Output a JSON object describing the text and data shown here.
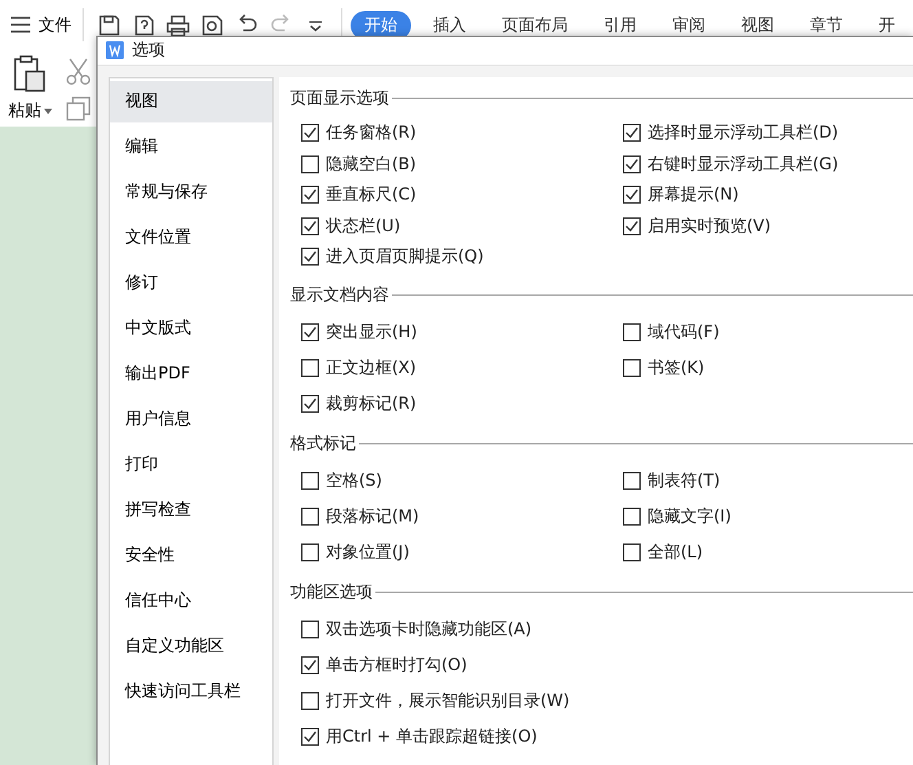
{
  "toolbar": {
    "menu_label": "文件",
    "tabs": [
      {
        "label": "开始",
        "selected": true
      },
      {
        "label": "插入",
        "selected": false
      },
      {
        "label": "页面布局",
        "selected": false
      },
      {
        "label": "引用",
        "selected": false
      },
      {
        "label": "审阅",
        "selected": false
      },
      {
        "label": "视图",
        "selected": false
      },
      {
        "label": "章节",
        "selected": false
      },
      {
        "label": "开",
        "selected": false
      }
    ],
    "paste_label": "粘贴"
  },
  "dialog": {
    "title": "选项",
    "nav": [
      {
        "label": "视图",
        "selected": true
      },
      {
        "label": "编辑",
        "selected": false
      },
      {
        "label": "常规与保存",
        "selected": false
      },
      {
        "label": "文件位置",
        "selected": false
      },
      {
        "label": "修订",
        "selected": false
      },
      {
        "label": "中文版式",
        "selected": false
      },
      {
        "label": "输出PDF",
        "selected": false
      },
      {
        "label": "用户信息",
        "selected": false
      },
      {
        "label": "打印",
        "selected": false
      },
      {
        "label": "拼写检查",
        "selected": false
      },
      {
        "label": "安全性",
        "selected": false
      },
      {
        "label": "信任中心",
        "selected": false
      },
      {
        "label": "自定义功能区",
        "selected": false
      },
      {
        "label": "快速访问工具栏",
        "selected": false
      }
    ],
    "sections": [
      {
        "title": "页面显示选项",
        "kind": "compact-grid",
        "options": [
          {
            "label": "任务窗格(R)",
            "checked": true
          },
          {
            "label": "选择时显示浮动工具栏(D)",
            "checked": true
          },
          {
            "label": "隐藏空白(B)",
            "checked": false
          },
          {
            "label": "右键时显示浮动工具栏(G)",
            "checked": true
          },
          {
            "label": "垂直标尺(C)",
            "checked": true
          },
          {
            "label": "屏幕提示(N)",
            "checked": true
          },
          {
            "label": "状态栏(U)",
            "checked": true
          },
          {
            "label": "启用实时预览(V)",
            "checked": true
          },
          {
            "label": "进入页眉页脚提示(Q)",
            "checked": true
          }
        ]
      },
      {
        "title": "显示文档内容",
        "kind": "grid",
        "options": [
          {
            "label": "突出显示(H)",
            "checked": true
          },
          {
            "label": "域代码(F)",
            "checked": false
          },
          {
            "label": "正文边框(X)",
            "checked": false
          },
          {
            "label": "书签(K)",
            "checked": false
          },
          {
            "label": "裁剪标记(R)",
            "checked": true
          }
        ]
      },
      {
        "title": "格式标记",
        "kind": "grid",
        "options": [
          {
            "label": "空格(S)",
            "checked": false
          },
          {
            "label": "制表符(T)",
            "checked": false
          },
          {
            "label": "段落标记(M)",
            "checked": false
          },
          {
            "label": "隐藏文字(I)",
            "checked": false
          },
          {
            "label": "对象位置(J)",
            "checked": false
          },
          {
            "label": "全部(L)",
            "checked": false
          }
        ]
      },
      {
        "title": "功能区选项",
        "kind": "list",
        "options": [
          {
            "label": "双击选项卡时隐藏功能区(A)",
            "checked": false
          },
          {
            "label": "单击方框时打勾(O)",
            "checked": true
          },
          {
            "label": "打开文件，展示智能识别目录(W)",
            "checked": false
          },
          {
            "label": "用Ctrl + 单击跟踪超链接(O)",
            "checked": true
          }
        ]
      }
    ]
  }
}
